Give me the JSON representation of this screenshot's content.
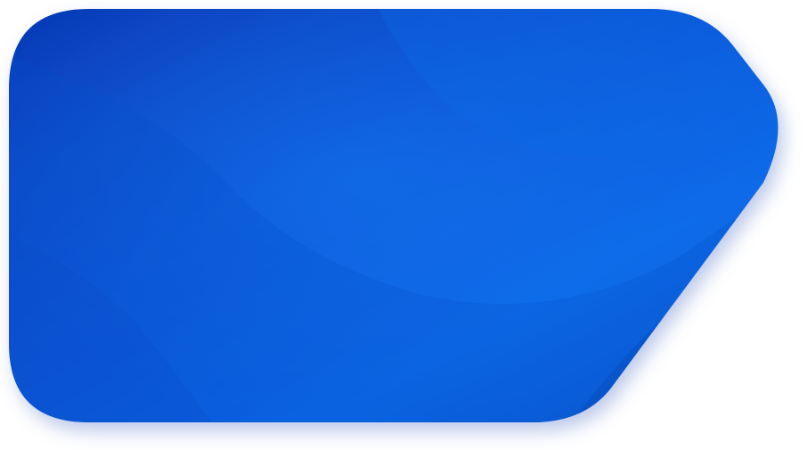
{
  "shape": {
    "kind": "tag-card",
    "colors": {
      "deep": "#0638b4",
      "base": "#0a56d8",
      "bright": "#0b69e8",
      "edge": "#0857cc",
      "shadow": "#6b86cf"
    }
  }
}
